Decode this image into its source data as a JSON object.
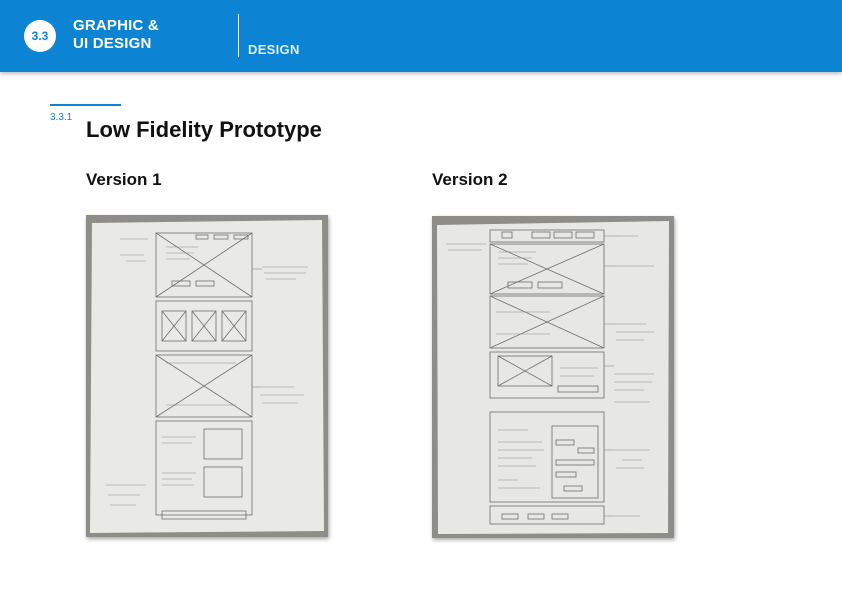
{
  "header": {
    "badge": "3.3",
    "title_line1": "GRAPHIC &",
    "title_line2": "UI DESIGN",
    "section": "DESIGN"
  },
  "section": {
    "number": "3.3.1",
    "title": "Low Fidelity Prototype"
  },
  "versions": [
    {
      "label": "Version 1"
    },
    {
      "label": "Version 2"
    }
  ],
  "colors": {
    "header_bg": "#0d84d3",
    "text": "#111111"
  }
}
